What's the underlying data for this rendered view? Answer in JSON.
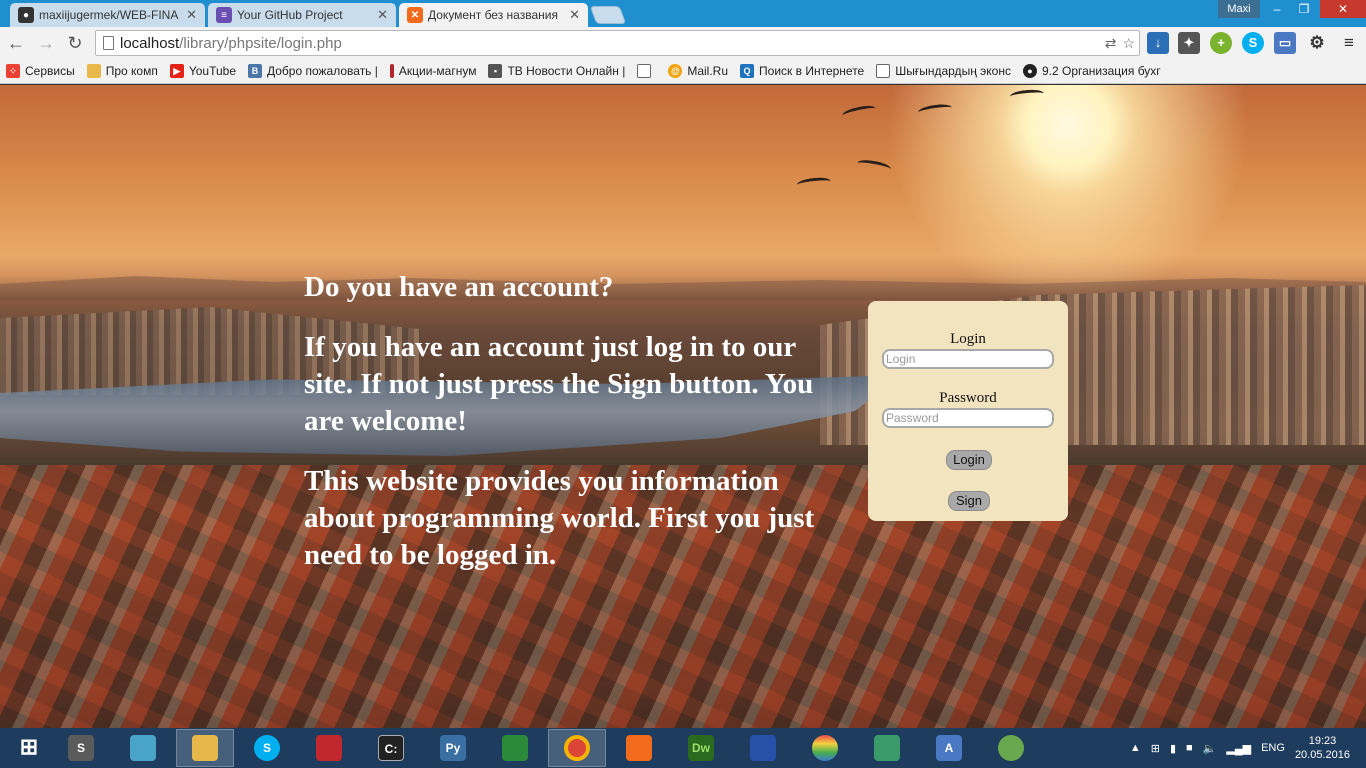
{
  "tabs": [
    {
      "title": "maxiijugermek/WEB-FINA",
      "icon": "github-icon",
      "color": "#333333"
    },
    {
      "title": "Your GitHub Project",
      "icon": "list-icon",
      "color": "#6a4fb0"
    },
    {
      "title": "Документ без названия",
      "icon": "xampp-icon",
      "color": "#f26b1d",
      "active": true
    }
  ],
  "profile_name": "Maxi",
  "address": {
    "host": "localhost",
    "path": "/library/phpsite/login.php"
  },
  "bookmarks": [
    {
      "label": "Сервисы",
      "icon": "apps-icon",
      "color": "#e94235"
    },
    {
      "label": "Про комп",
      "icon": "folder-icon",
      "color": "#e8b84a"
    },
    {
      "label": "YouTube",
      "icon": "youtube-icon",
      "color": "#e62117"
    },
    {
      "label": "Добро пожаловать |",
      "icon": "vk-icon",
      "color": "#4a76a8"
    },
    {
      "label": "Акции-магнум",
      "icon": "magnum-icon",
      "color": "#b3262c"
    },
    {
      "label": "ТВ Новости Онлайн |",
      "icon": "tv-icon",
      "color": "#555555"
    },
    {
      "label": "",
      "icon": "page-icon",
      "color": "#dddddd"
    },
    {
      "label": "Mail.Ru",
      "icon": "mailru-icon",
      "color": "#f4a20b"
    },
    {
      "label": "Поиск в Интернете",
      "icon": "search-icon",
      "color": "#1e73be"
    },
    {
      "label": "Шығындардың эконс",
      "icon": "page-icon",
      "color": "#dddddd"
    },
    {
      "label": "9.2 Организация бухг",
      "icon": "globe-icon",
      "color": "#222222"
    }
  ],
  "page": {
    "heading": "Do you have an account?",
    "paragraph1": "If you have an account just log in to our site. If not just press the Sign button. You are welcome!",
    "paragraph2": "This website provides you information about programming world. First you just need to be logged in."
  },
  "login_form": {
    "login_label": "Login",
    "login_placeholder": "Login",
    "password_label": "Password",
    "password_placeholder": "Password",
    "login_button": "Login",
    "sign_button": "Sign"
  },
  "taskbar": {
    "apps": [
      {
        "name": "sublime-icon",
        "label": "S",
        "color": "#5a5a5a"
      },
      {
        "name": "notes-icon",
        "label": "",
        "color": "#4aa3c9"
      },
      {
        "name": "explorer-icon",
        "label": "",
        "color": "#e6b84c",
        "active": true
      },
      {
        "name": "skype-icon",
        "label": "S",
        "color": "#00aff0"
      },
      {
        "name": "book-icon",
        "label": "",
        "color": "#c0282d"
      },
      {
        "name": "terminal-icon",
        "label": "C:",
        "color": "#222222"
      },
      {
        "name": "python-icon",
        "label": "Py",
        "color": "#3a6fa3"
      },
      {
        "name": "calculator-icon",
        "label": "",
        "color": "#2a8a3a"
      },
      {
        "name": "chrome-icon",
        "label": "",
        "color": "#db4437",
        "active": true
      },
      {
        "name": "xampp-icon",
        "label": "",
        "color": "#f26b1d"
      },
      {
        "name": "dreamweaver-icon",
        "label": "Dw",
        "color": "#2a6a1f"
      },
      {
        "name": "save-icon",
        "label": "",
        "color": "#2850a8"
      },
      {
        "name": "rainbow-icon",
        "label": "",
        "color": "#e94a4a"
      },
      {
        "name": "network-icon",
        "label": "",
        "color": "#3a9a6a"
      },
      {
        "name": "translate-icon",
        "label": "A",
        "color": "#4a78c2"
      },
      {
        "name": "android-icon",
        "label": "",
        "color": "#6aa84f"
      }
    ],
    "language": "ENG",
    "time": "19:23",
    "date": "20.05.2016"
  }
}
